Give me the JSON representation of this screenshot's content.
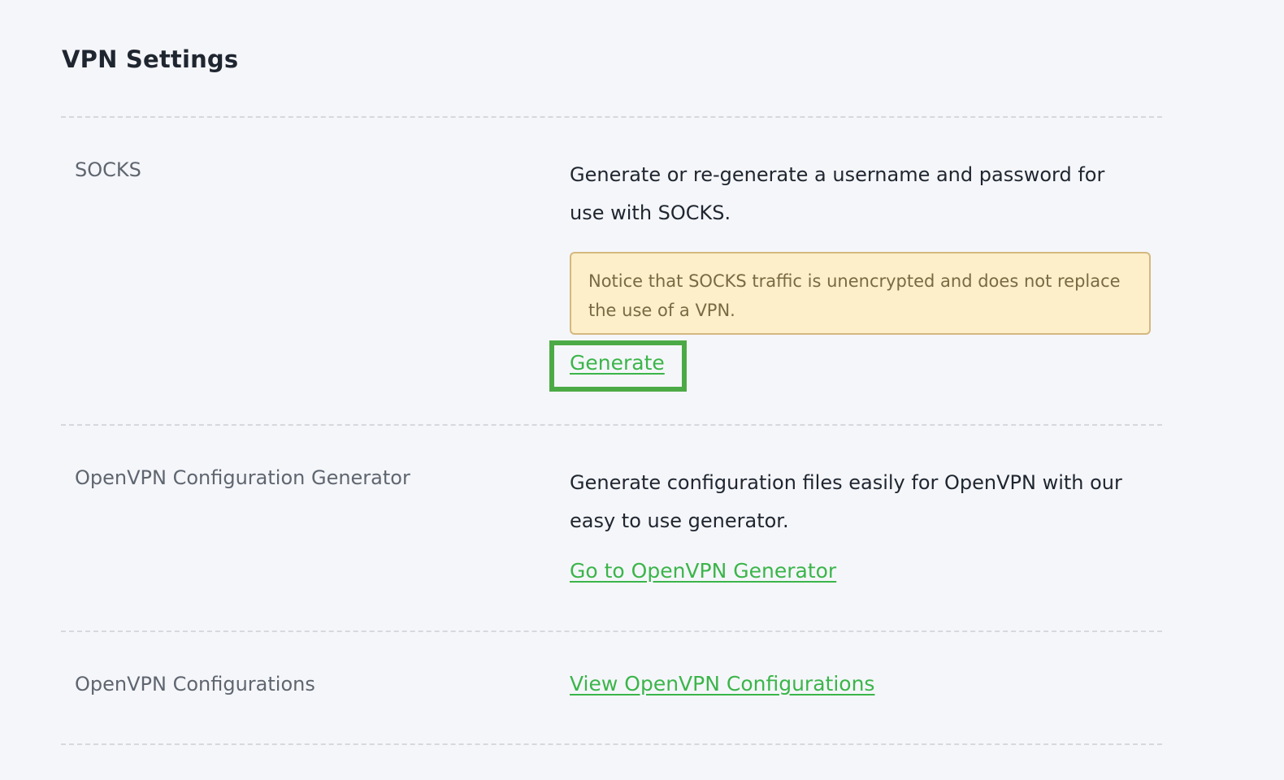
{
  "page": {
    "title": "VPN Settings"
  },
  "sections": [
    {
      "label": "SOCKS",
      "description": "Generate or re-generate a username and password for use with SOCKS.",
      "notice": "Notice that SOCKS traffic is unencrypted and does not replace the use of a VPN.",
      "link": "Generate"
    },
    {
      "label": "OpenVPN Configuration Generator",
      "description": "Generate configuration files easily for OpenVPN with our easy to use generator.",
      "link": "Go to OpenVPN Generator"
    },
    {
      "label": "OpenVPN Configurations",
      "link": "View OpenVPN Configurations"
    }
  ],
  "colors": {
    "link": "#3bb54a",
    "notice_background": "#fcefc9",
    "notice_border": "#d5b880",
    "highlight": "#4caa46"
  }
}
